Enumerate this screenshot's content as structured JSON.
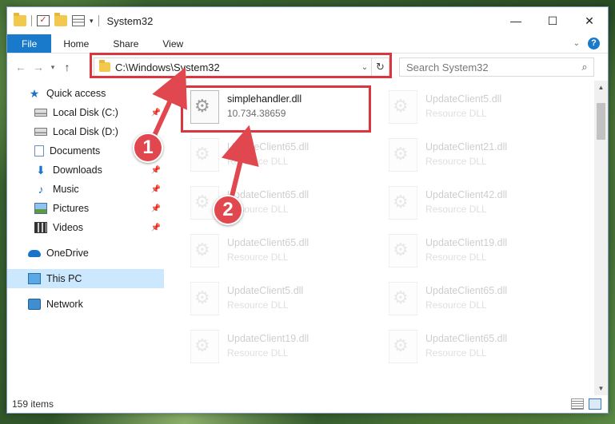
{
  "window": {
    "title": "System32",
    "controls": {
      "minimize": "—",
      "maximize": "☐",
      "close": "✕"
    }
  },
  "ribbon": {
    "tabs": [
      "File",
      "Home",
      "Share",
      "View"
    ],
    "help": "?"
  },
  "nav": {
    "back": "←",
    "forward": "→",
    "recent": "▾",
    "up": "↑",
    "address": "C:\\Windows\\System32",
    "search_placeholder": "Search System32"
  },
  "sidebar": {
    "items": [
      {
        "label": "Quick access",
        "icon": "star-icon",
        "pinned": false
      },
      {
        "label": "Local Disk (C:)",
        "icon": "drive-icon",
        "pinned": true
      },
      {
        "label": "Local Disk (D:)",
        "icon": "drive-icon",
        "pinned": false
      },
      {
        "label": "Documents",
        "icon": "documents-icon",
        "pinned": false
      },
      {
        "label": "Downloads",
        "icon": "download-icon",
        "pinned": true
      },
      {
        "label": "Music",
        "icon": "music-icon",
        "pinned": true
      },
      {
        "label": "Pictures",
        "icon": "pictures-icon",
        "pinned": true
      },
      {
        "label": "Videos",
        "icon": "videos-icon",
        "pinned": true
      }
    ],
    "onedrive": "OneDrive",
    "this_pc": "This PC",
    "network": "Network",
    "pin_glyph": "📌"
  },
  "files": {
    "main": {
      "name": "simplehandler.dll",
      "detail": "10.734.38659"
    },
    "left_column": [
      {
        "name": "UpdateClient65.dll",
        "detail": "Resource DLL"
      },
      {
        "name": "UpdateClient65.dll",
        "detail": "Resource DLL"
      },
      {
        "name": "UpdateClient65.dll",
        "detail": "Resource DLL"
      },
      {
        "name": "UpdateClient5.dll",
        "detail": "Resource DLL"
      },
      {
        "name": "UpdateClient19.dll",
        "detail": "Resource DLL"
      }
    ],
    "right_column": [
      {
        "name": "UpdateClient5.dll",
        "detail": "Resource DLL"
      },
      {
        "name": "UpdateClient21.dll",
        "detail": "Resource DLL"
      },
      {
        "name": "UpdateClient42.dll",
        "detail": "Resource DLL"
      },
      {
        "name": "UpdateClient19.dll",
        "detail": "Resource DLL"
      },
      {
        "name": "UpdateClient65.dll",
        "detail": "Resource DLL"
      },
      {
        "name": "UpdateClient65.dll",
        "detail": "Resource DLL"
      }
    ]
  },
  "status": {
    "item_count": "159 items"
  },
  "callouts": {
    "one": "1",
    "two": "2"
  },
  "colors": {
    "highlight": "#d9363e",
    "callout": "#e0474e",
    "accent": "#1979ca"
  }
}
